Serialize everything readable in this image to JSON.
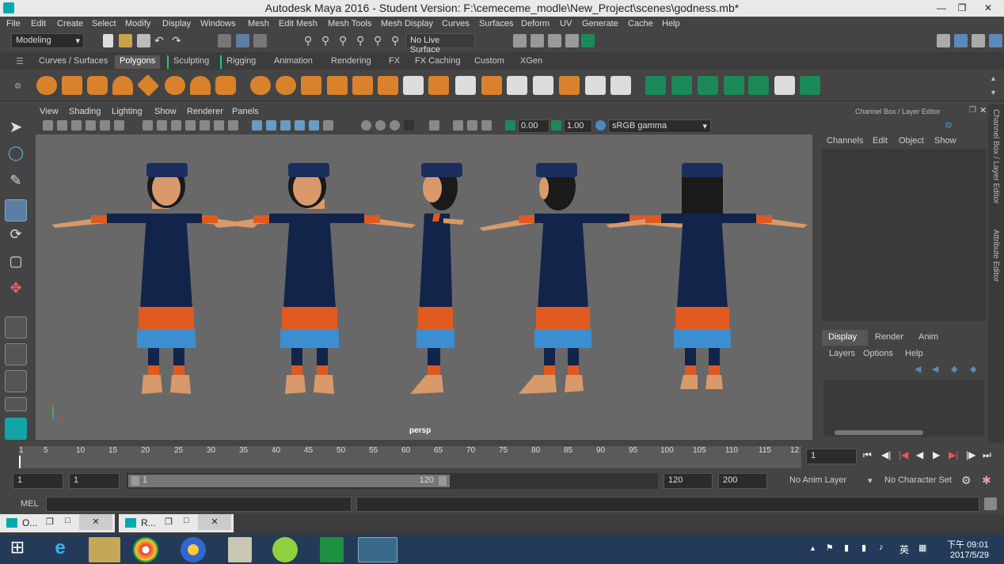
{
  "window": {
    "title": "Autodesk Maya 2016 - Student Version: F:\\cemeceme_modle\\New_Project\\scenes\\godness.mb*"
  },
  "menu": [
    "File",
    "Edit",
    "Create",
    "Select",
    "Modify",
    "Display",
    "Windows",
    "Mesh",
    "Edit Mesh",
    "Mesh Tools",
    "Mesh Display",
    "Curves",
    "Surfaces",
    "Deform",
    "UV",
    "Generate",
    "Cache",
    "Help"
  ],
  "status": {
    "menuset": "Modeling",
    "live_surface": "No Live Surface"
  },
  "shelf_tabs": [
    "Curves / Surfaces",
    "Polygons",
    "Sculpting",
    "Rigging",
    "Animation",
    "Rendering",
    "FX",
    "FX Caching",
    "Custom",
    "XGen"
  ],
  "panel_menu": [
    "View",
    "Shading",
    "Lighting",
    "Show",
    "Renderer",
    "Panels"
  ],
  "panel_values": {
    "exposure": "0.00",
    "gamma": "1.00",
    "colorspace": "sRGB gamma"
  },
  "viewport": {
    "camera": "persp"
  },
  "channel_box": {
    "title": "Channel Box / Layer Editor",
    "menu": [
      "Channels",
      "Edit",
      "Object",
      "Show"
    ],
    "layer_tabs": [
      "Display",
      "Render",
      "Anim"
    ],
    "layer_menu": [
      "Layers",
      "Options",
      "Help"
    ]
  },
  "side_tabs": {
    "channel": "Channel Box / Layer Editor",
    "attr": "Attribute Editor"
  },
  "timeline": {
    "ticks": [
      "1",
      "5",
      "10",
      "15",
      "20",
      "25",
      "30",
      "35",
      "40",
      "45",
      "50",
      "55",
      "60",
      "65",
      "70",
      "75",
      "80",
      "85",
      "90",
      "95",
      "100",
      "105",
      "110",
      "115",
      "12"
    ],
    "current": "1"
  },
  "range": {
    "start": "1",
    "start_inner": "1",
    "slider_start": "1",
    "slider_end": "120",
    "end": "120",
    "end_outer": "200",
    "anim_layer": "No Anim Layer",
    "character_set": "No Character Set"
  },
  "command": {
    "label": "MEL"
  },
  "minimized": [
    {
      "label": "O..."
    },
    {
      "label": "R..."
    }
  ],
  "taskbar": {
    "time": "下午 09:01",
    "date": "2017/5/29",
    "ime": "英"
  }
}
